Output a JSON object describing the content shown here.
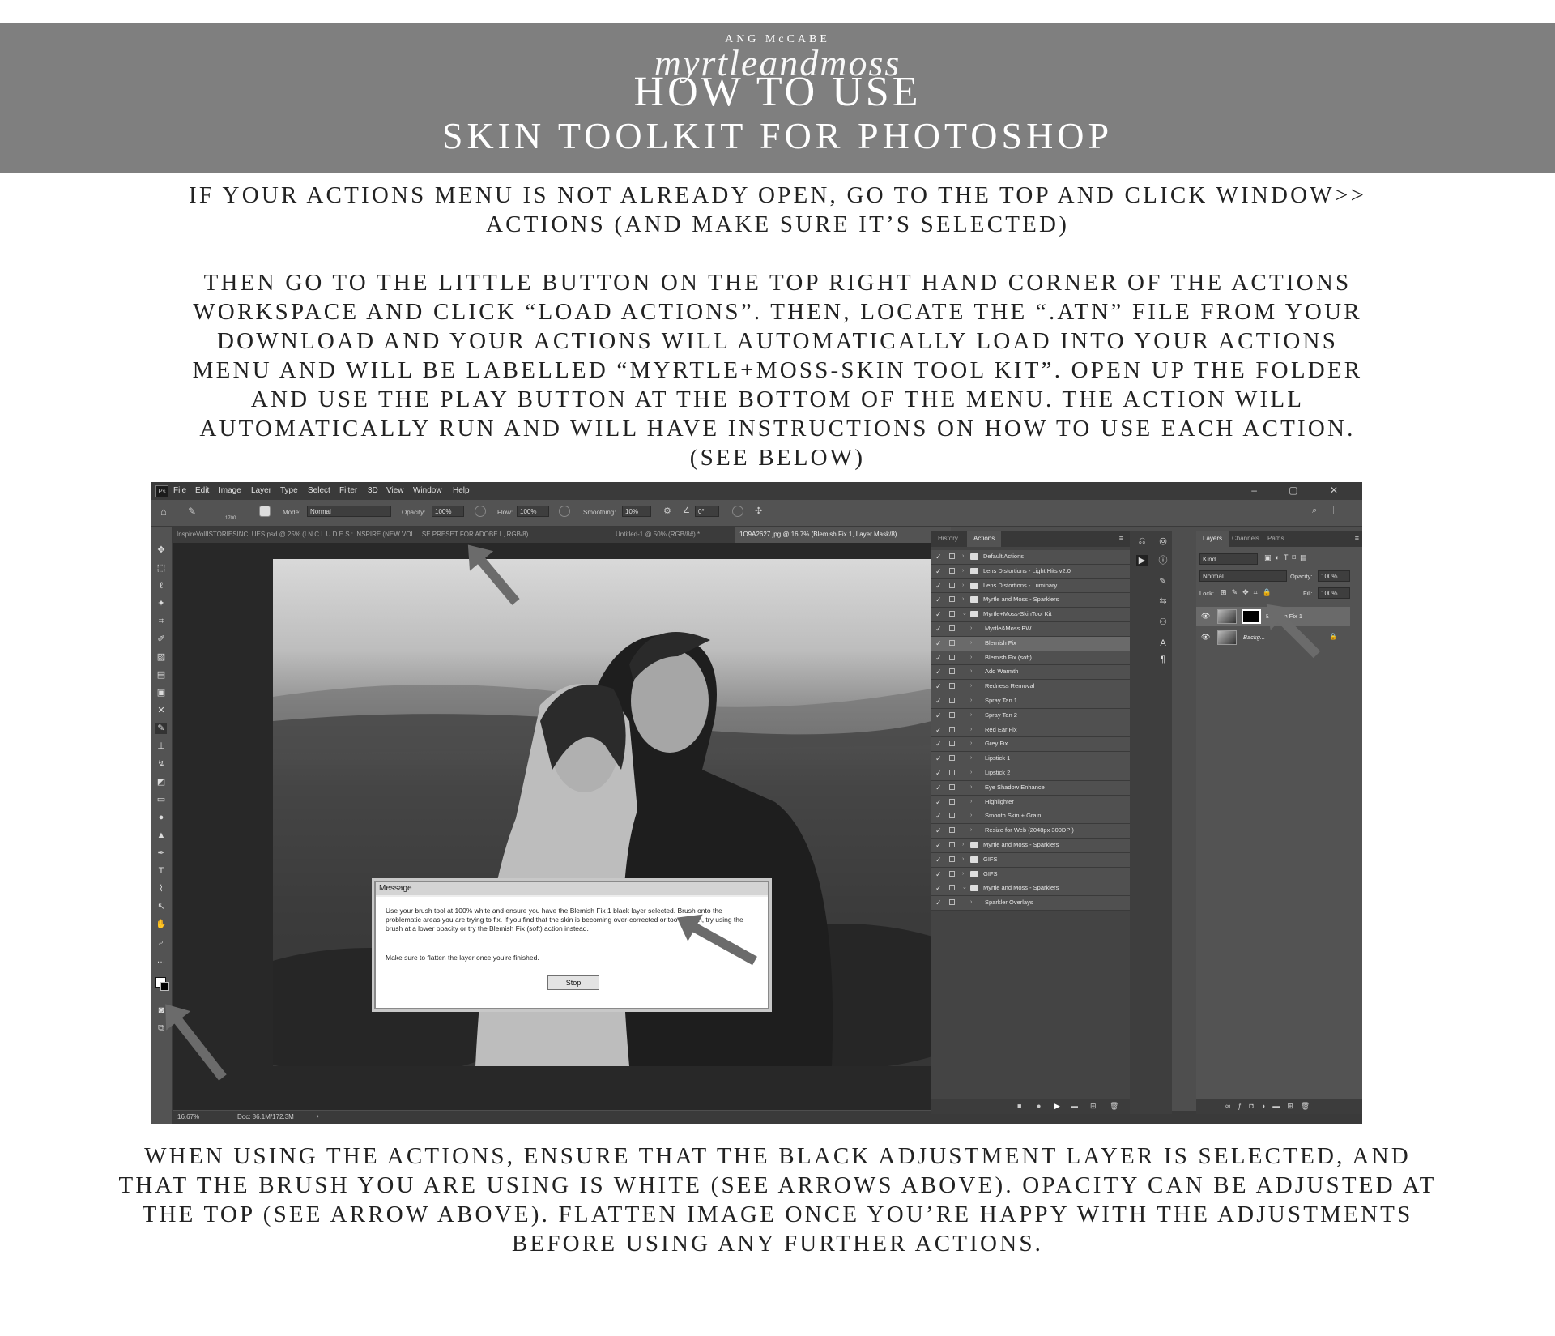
{
  "header": {
    "brand_small": "ANG McCABE",
    "brand_script": "myrtleandmoss",
    "title_line1": "HOW TO USE",
    "title_line2": "SKIN TOOLKIT FOR PHOTOSHOP"
  },
  "intro": {
    "lines": [
      "IF YOUR ACTIONS MENU IS NOT ALREADY OPEN, GO TO THE TOP AND CLICK WINDOW>>",
      "ACTIONS (AND MAKE SURE IT’S SELECTED)"
    ]
  },
  "steps": {
    "lines": [
      "THEN GO TO THE LITTLE BUTTON ON THE TOP RIGHT HAND CORNER OF THE ACTIONS",
      "WORKSPACE AND CLICK “LOAD ACTIONS”. THEN, LOCATE THE “.ATN” FILE FROM YOUR",
      "DOWNLOAD AND YOUR ACTIONS WILL AUTOMATICALLY LOAD INTO YOUR ACTIONS",
      "MENU AND WILL BE LABELLED “MYRTLE+MOSS-SKIN TOOL KIT”. OPEN UP THE FOLDER",
      "AND USE THE PLAY BUTTON AT THE BOTTOM OF THE MENU. THE ACTION WILL",
      "AUTOMATICALLY RUN AND WILL HAVE INSTRUCTIONS ON HOW TO USE EACH ACTION.",
      "(SEE BELOW)"
    ]
  },
  "footer": {
    "lines": [
      "WHEN USING THE ACTIONS, ENSURE THAT THE BLACK ADJUSTMENT LAYER IS SELECTED, AND",
      "THAT THE BRUSH YOU ARE USING IS WHITE (SEE ARROWS ABOVE). OPACITY CAN BE ADJUSTED AT",
      "THE TOP (SEE ARROW ABOVE). FLATTEN IMAGE ONCE YOU’RE HAPPY WITH THE ADJUSTMENTS",
      "BEFORE USING ANY FURTHER ACTIONS."
    ]
  },
  "photoshop": {
    "logo": "Ps",
    "menu": [
      "File",
      "Edit",
      "Image",
      "Layer",
      "Type",
      "Select",
      "Filter",
      "3D",
      "View",
      "Window",
      "Help"
    ],
    "window_controls": "– ▢ ✕",
    "options": {
      "brush_size": "1700",
      "mode_label": "Mode:",
      "mode_value": "Normal",
      "opacity_label": "Opacity:",
      "opacity_value": "100%",
      "flow_label": "Flow:",
      "flow_value": "100%",
      "smoothing_label": "Smoothing:",
      "smoothing_value": "10%",
      "angle_value": "0°"
    },
    "tabs": [
      "InspireVolIISTORIESINCLUES.psd @ 25% (I N C L U D E S : INSPIRE (NEW VOL... SE PRESET FOR ADOBE L, RGB/8)",
      "Untitled-1 @ 50% (RGB/8#) *",
      "1O9A2627.jpg @ 16.7% (Blemish Fix 1, Layer Mask/8)"
    ],
    "status": {
      "zoom": "16.67%",
      "doc": "Doc: 86.1M/172.3M"
    },
    "dialog": {
      "title": "Message",
      "message": "Use your brush tool at 100% white and ensure you have the Blemish Fix 1 black layer selected. Brush onto the problematic areas you are trying to fix. If you find that the skin is becoming over-corrected or too smooth, try using the brush at a lower opacity or try the Blemish Fix (soft) action instead.",
      "message2": "Make sure to flatten the layer once you're finished.",
      "button": "Stop"
    },
    "actions_panel": {
      "tabs": [
        "History",
        "Actions"
      ],
      "items": [
        {
          "label": "Default Actions",
          "folder": true,
          "level": 0
        },
        {
          "label": "Lens Distortions - Light Hits v2.0",
          "folder": true,
          "level": 0
        },
        {
          "label": "Lens Distortions - Luminary",
          "folder": true,
          "level": 0
        },
        {
          "label": "Myrtle and Moss - Sparklers",
          "folder": true,
          "level": 0
        },
        {
          "label": "Myrtle+Moss-SkinTool Kit",
          "folder": true,
          "level": 0,
          "open": true
        },
        {
          "label": "Myrtle&Moss BW",
          "folder": false,
          "level": 1
        },
        {
          "label": "Blemish Fix",
          "folder": false,
          "level": 1,
          "selected": true
        },
        {
          "label": "Blemish Fix (soft)",
          "folder": false,
          "level": 1
        },
        {
          "label": "Add Warmth",
          "folder": false,
          "level": 1
        },
        {
          "label": "Redness Removal",
          "folder": false,
          "level": 1
        },
        {
          "label": "Spray Tan 1",
          "folder": false,
          "level": 1
        },
        {
          "label": "Spray Tan 2",
          "folder": false,
          "level": 1
        },
        {
          "label": "Red Ear Fix",
          "folder": false,
          "level": 1
        },
        {
          "label": "Grey Fix",
          "folder": false,
          "level": 1
        },
        {
          "label": "Lipstick 1",
          "folder": false,
          "level": 1
        },
        {
          "label": "Lipstick 2",
          "folder": false,
          "level": 1
        },
        {
          "label": "Eye Shadow Enhance",
          "folder": false,
          "level": 1
        },
        {
          "label": "Highlighter",
          "folder": false,
          "level": 1
        },
        {
          "label": "Smooth Skin + Grain",
          "folder": false,
          "level": 1
        },
        {
          "label": "Resize for Web (2048px 300DPI)",
          "folder": false,
          "level": 1
        },
        {
          "label": "Myrtle and Moss - Sparklers",
          "folder": true,
          "level": 0
        },
        {
          "label": "GIFS",
          "folder": true,
          "level": 0
        },
        {
          "label": "GIFS",
          "folder": true,
          "level": 0
        },
        {
          "label": "Myrtle and Moss - Sparklers",
          "folder": true,
          "level": 0,
          "open": true
        },
        {
          "label": "Sparkler Overlays",
          "folder": false,
          "level": 1
        }
      ]
    },
    "layers_panel": {
      "tabs": [
        "Layers",
        "Channels",
        "Paths"
      ],
      "kind_label": "Kind",
      "blend": "Normal",
      "opacity_label": "Opacity:",
      "opacity_value": "100%",
      "lock_label": "Lock:",
      "fill_label": "Fill:",
      "fill_value": "100%",
      "layers": [
        {
          "name": "Blemish Fix 1"
        },
        {
          "name": "Backg..."
        }
      ]
    }
  },
  "colors": {
    "banner": "#7f7f7f",
    "arrow": "#6b6b6b",
    "ps_bg": "#535353"
  }
}
